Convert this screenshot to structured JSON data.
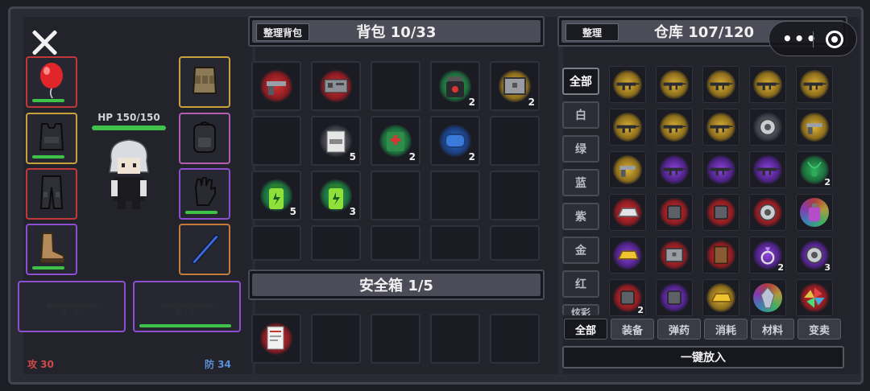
{
  "character": {
    "hp_label": "HP 150/150",
    "attack": "攻 30",
    "defense": "防 34",
    "slots": [
      {
        "name": "balloon",
        "rarity": "red",
        "icon": "balloon-icon"
      },
      {
        "name": "body-armor",
        "rarity": "gold",
        "icon": "vest-icon"
      },
      {
        "name": "pants",
        "rarity": "red",
        "icon": "pants-icon"
      },
      {
        "name": "boots",
        "rarity": "purple",
        "icon": "boots-icon"
      },
      {
        "name": "tactical-vest",
        "rarity": "gold",
        "icon": "rig-icon"
      },
      {
        "name": "backpack",
        "rarity": "gold",
        "icon": "backpack-icon"
      },
      {
        "name": "gloves",
        "rarity": "purple",
        "icon": "gloves-icon"
      },
      {
        "name": "blade",
        "rarity": "gold",
        "icon": "sword-icon"
      }
    ],
    "weapons": [
      {
        "icon": "rifle-icon",
        "has_bar": false
      },
      {
        "icon": "rifle-icon",
        "has_bar": true
      }
    ]
  },
  "backpack": {
    "sort_label": "整理背包",
    "title": "背包 10/33",
    "items": [
      {
        "icon": "pistol-frame-icon",
        "glow": "red",
        "count": ""
      },
      {
        "icon": "circuit-board-icon",
        "glow": "red",
        "count": ""
      },
      {
        "icon": "",
        "glow": "",
        "count": ""
      },
      {
        "icon": "supplement-jar-icon",
        "glow": "green",
        "count": "2"
      },
      {
        "icon": "metal-crate-icon",
        "glow": "gold",
        "count": "2"
      },
      {
        "icon": "",
        "glow": "",
        "count": ""
      },
      {
        "icon": "ration-pack-icon",
        "glow": "white",
        "count": "5"
      },
      {
        "icon": "first-aid-pouch-icon",
        "glow": "green",
        "count": "2"
      },
      {
        "icon": "bandage-roll-icon",
        "glow": "blue",
        "count": "2"
      },
      {
        "icon": "",
        "glow": "",
        "count": ""
      },
      {
        "icon": "energy-drink-icon",
        "glow": "green",
        "count": "5"
      },
      {
        "icon": "energy-drink-icon",
        "glow": "green",
        "count": "3"
      },
      {
        "icon": "",
        "glow": "",
        "count": ""
      },
      {
        "icon": "",
        "glow": "",
        "count": ""
      },
      {
        "icon": "",
        "glow": "",
        "count": ""
      },
      {
        "icon": "",
        "glow": "",
        "count": ""
      },
      {
        "icon": "",
        "glow": "",
        "count": ""
      },
      {
        "icon": "",
        "glow": "",
        "count": ""
      },
      {
        "icon": "",
        "glow": "",
        "count": ""
      },
      {
        "icon": "",
        "glow": "",
        "count": ""
      }
    ]
  },
  "safebox": {
    "title": "安全箱 1/5",
    "items": [
      {
        "icon": "document-icon",
        "glow": "red",
        "count": ""
      },
      {
        "icon": "",
        "glow": "",
        "count": ""
      },
      {
        "icon": "",
        "glow": "",
        "count": ""
      },
      {
        "icon": "",
        "glow": "",
        "count": ""
      },
      {
        "icon": "",
        "glow": "",
        "count": ""
      }
    ]
  },
  "warehouse": {
    "sort_label": "整理",
    "title": "仓库 107/120",
    "rarity_tabs": [
      "全部",
      "白",
      "绿",
      "蓝",
      "紫",
      "金",
      "红",
      "炫彩"
    ],
    "category_tabs": [
      "全部",
      "装备",
      "弹药",
      "消耗",
      "材料",
      "变卖"
    ],
    "deposit_all": "一键放入",
    "items": [
      {
        "icon": "rifle-icon",
        "glow": "gold",
        "count": ""
      },
      {
        "icon": "rifle-icon",
        "glow": "gold",
        "count": ""
      },
      {
        "icon": "rifle-icon",
        "glow": "gold",
        "count": ""
      },
      {
        "icon": "rifle-icon",
        "glow": "gold",
        "count": ""
      },
      {
        "icon": "sniper-icon",
        "glow": "gold",
        "count": ""
      },
      {
        "icon": "sniper-icon",
        "glow": "gold",
        "count": ""
      },
      {
        "icon": "rifle-icon",
        "glow": "gold",
        "count": ""
      },
      {
        "icon": "smg-icon",
        "glow": "gold",
        "count": ""
      },
      {
        "icon": "gear-icon",
        "glow": "white",
        "count": ""
      },
      {
        "icon": "pistol-icon",
        "glow": "gold",
        "count": ""
      },
      {
        "icon": "pistol-icon",
        "glow": "gold",
        "count": ""
      },
      {
        "icon": "rifle-icon",
        "glow": "purple",
        "count": ""
      },
      {
        "icon": "rifle-icon",
        "glow": "purple",
        "count": ""
      },
      {
        "icon": "smg-icon",
        "glow": "purple",
        "count": ""
      },
      {
        "icon": "necklace-icon",
        "glow": "green",
        "count": "2"
      },
      {
        "icon": "silver-bar-icon",
        "glow": "red",
        "count": ""
      },
      {
        "icon": "camera-lens-icon",
        "glow": "red",
        "count": ""
      },
      {
        "icon": "engine-part-icon",
        "glow": "red",
        "count": ""
      },
      {
        "icon": "clock-icon",
        "glow": "red",
        "count": ""
      },
      {
        "icon": "potion-icon",
        "glow": "rainbow",
        "count": ""
      },
      {
        "icon": "gold-bar-icon",
        "glow": "purple",
        "count": ""
      },
      {
        "icon": "safe-icon",
        "glow": "red",
        "count": ""
      },
      {
        "icon": "leather-book-icon",
        "glow": "red",
        "count": ""
      },
      {
        "icon": "ring-icon",
        "glow": "purple",
        "count": "2"
      },
      {
        "icon": "pocket-watch-icon",
        "glow": "purple",
        "count": "3"
      },
      {
        "icon": "lantern-icon",
        "glow": "red",
        "count": "2"
      },
      {
        "icon": "tank-toy-icon",
        "glow": "purple",
        "count": ""
      },
      {
        "icon": "gold-bar-icon",
        "glow": "gold",
        "count": ""
      },
      {
        "icon": "crystal-icon",
        "glow": "rainbow",
        "count": ""
      },
      {
        "icon": "pinwheel-icon",
        "glow": "red",
        "count": ""
      }
    ]
  },
  "colors": {
    "red": "#c2373a",
    "gold": "#c9a13a",
    "purple": "#8c4fcf",
    "green_bar": "#3fc24a",
    "attack": "#d04a4a",
    "defense": "#5b8fd8"
  }
}
